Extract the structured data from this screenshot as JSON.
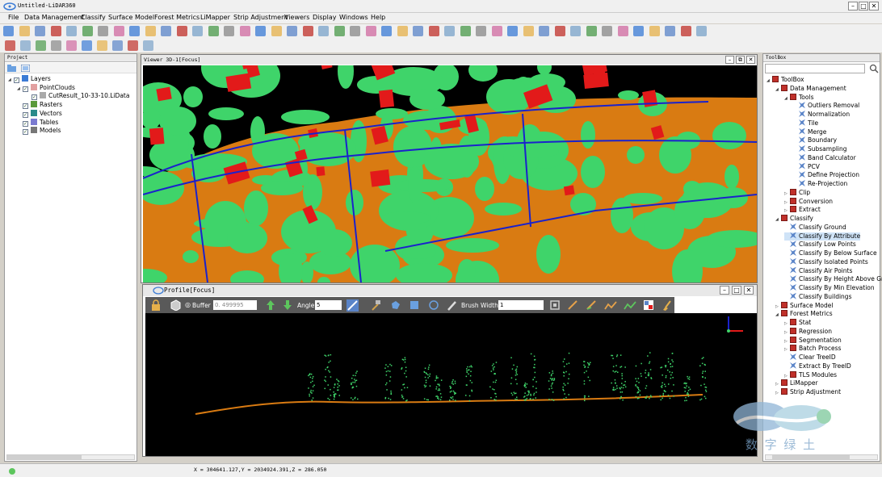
{
  "app": {
    "title": "Untitled-LiDAR360",
    "menu": [
      "File",
      "Data Management",
      "Classify",
      "Surface Model",
      "Forest Metrics",
      "LiMapper",
      "Strip Adjustment",
      "Viewers",
      "Display",
      "Windows",
      "Help"
    ]
  },
  "project": {
    "title": "Project",
    "tree": [
      {
        "label": "Layers",
        "level": 0,
        "expanded": true,
        "checked": true
      },
      {
        "label": "PointClouds",
        "level": 1,
        "expanded": true,
        "checked": true
      },
      {
        "label": "CutResult_10-33-10.LiData",
        "level": 2,
        "checked": true
      },
      {
        "label": "Rasters",
        "level": 1,
        "checked": true
      },
      {
        "label": "Vectors",
        "level": 1,
        "checked": true
      },
      {
        "label": "Tables",
        "level": 1,
        "checked": true
      },
      {
        "label": "Models",
        "level": 1,
        "checked": true
      }
    ]
  },
  "viewer3d": {
    "title": "Viewer 3D-1[Focus]"
  },
  "profile": {
    "title": "Profile[Focus]",
    "buffer_label": "Buffer",
    "buffer_value": "0. 499995",
    "angle_label": "Angle",
    "angle_value": "5",
    "brush_label": "Brush Width",
    "brush_value": "1"
  },
  "toolbox": {
    "title": "ToolBox",
    "tree": [
      {
        "label": "ToolBox",
        "level": 0,
        "type": "folder",
        "expanded": true
      },
      {
        "label": "Data Management",
        "level": 1,
        "type": "folder",
        "expanded": true
      },
      {
        "label": "Tools",
        "level": 2,
        "type": "folder",
        "expanded": true
      },
      {
        "label": "Outliers Removal",
        "level": 3,
        "type": "tool"
      },
      {
        "label": "Normalization",
        "level": 3,
        "type": "tool"
      },
      {
        "label": "Tile",
        "level": 3,
        "type": "tool"
      },
      {
        "label": "Merge",
        "level": 3,
        "type": "tool"
      },
      {
        "label": "Boundary",
        "level": 3,
        "type": "tool"
      },
      {
        "label": "Subsampling",
        "level": 3,
        "type": "tool"
      },
      {
        "label": "Band Calculator",
        "level": 3,
        "type": "tool"
      },
      {
        "label": "PCV",
        "level": 3,
        "type": "tool"
      },
      {
        "label": "Define Projection",
        "level": 3,
        "type": "tool"
      },
      {
        "label": "Re-Projection",
        "level": 3,
        "type": "tool"
      },
      {
        "label": "Clip",
        "level": 2,
        "type": "folder",
        "expanded": false
      },
      {
        "label": "Conversion",
        "level": 2,
        "type": "folder",
        "expanded": false
      },
      {
        "label": "Extract",
        "level": 2,
        "type": "folder",
        "expanded": false
      },
      {
        "label": "Classify",
        "level": 1,
        "type": "folder",
        "expanded": true
      },
      {
        "label": "Classify Ground",
        "level": 2,
        "type": "tool"
      },
      {
        "label": "Classify By Attribute",
        "level": 2,
        "type": "tool",
        "selected": true
      },
      {
        "label": "Classify Low Points",
        "level": 2,
        "type": "tool"
      },
      {
        "label": "Classify By Below Surface",
        "level": 2,
        "type": "tool"
      },
      {
        "label": "Classify Isolated Points",
        "level": 2,
        "type": "tool"
      },
      {
        "label": "Classify Air Points",
        "level": 2,
        "type": "tool"
      },
      {
        "label": "Classify By Height Above Gro",
        "level": 2,
        "type": "tool"
      },
      {
        "label": "Classify By Min Elevation",
        "level": 2,
        "type": "tool"
      },
      {
        "label": "Classify Buildings",
        "level": 2,
        "type": "tool"
      },
      {
        "label": "Surface Model",
        "level": 1,
        "type": "folder",
        "expanded": false
      },
      {
        "label": "Forest Metrics",
        "level": 1,
        "type": "folder",
        "expanded": true
      },
      {
        "label": "Stat",
        "level": 2,
        "type": "folder",
        "expanded": false
      },
      {
        "label": "Regression",
        "level": 2,
        "type": "folder",
        "expanded": false
      },
      {
        "label": "Segmentation",
        "level": 2,
        "type": "folder",
        "expanded": false
      },
      {
        "label": "Batch Process",
        "level": 2,
        "type": "folder",
        "expanded": false
      },
      {
        "label": "Clear TreeID",
        "level": 2,
        "type": "tool"
      },
      {
        "label": "Extract By TreeID",
        "level": 2,
        "type": "tool"
      },
      {
        "label": "TLS Modules",
        "level": 2,
        "type": "folder",
        "expanded": false
      },
      {
        "label": "LiMapper",
        "level": 1,
        "type": "folder",
        "expanded": false
      },
      {
        "label": "Strip Adjustment",
        "level": 1,
        "type": "folder",
        "expanded": false
      }
    ]
  },
  "status": {
    "coords": "X = 304641.127,Y = 2034924.391,Z = 286.050"
  },
  "watermark": {
    "text": "数 字 绿 土"
  },
  "colors": {
    "ground": "#d97b12",
    "vegetation": "#3fd46a",
    "building": "#e21a1a",
    "powerline": "#1a22cc",
    "background": "#000000"
  }
}
